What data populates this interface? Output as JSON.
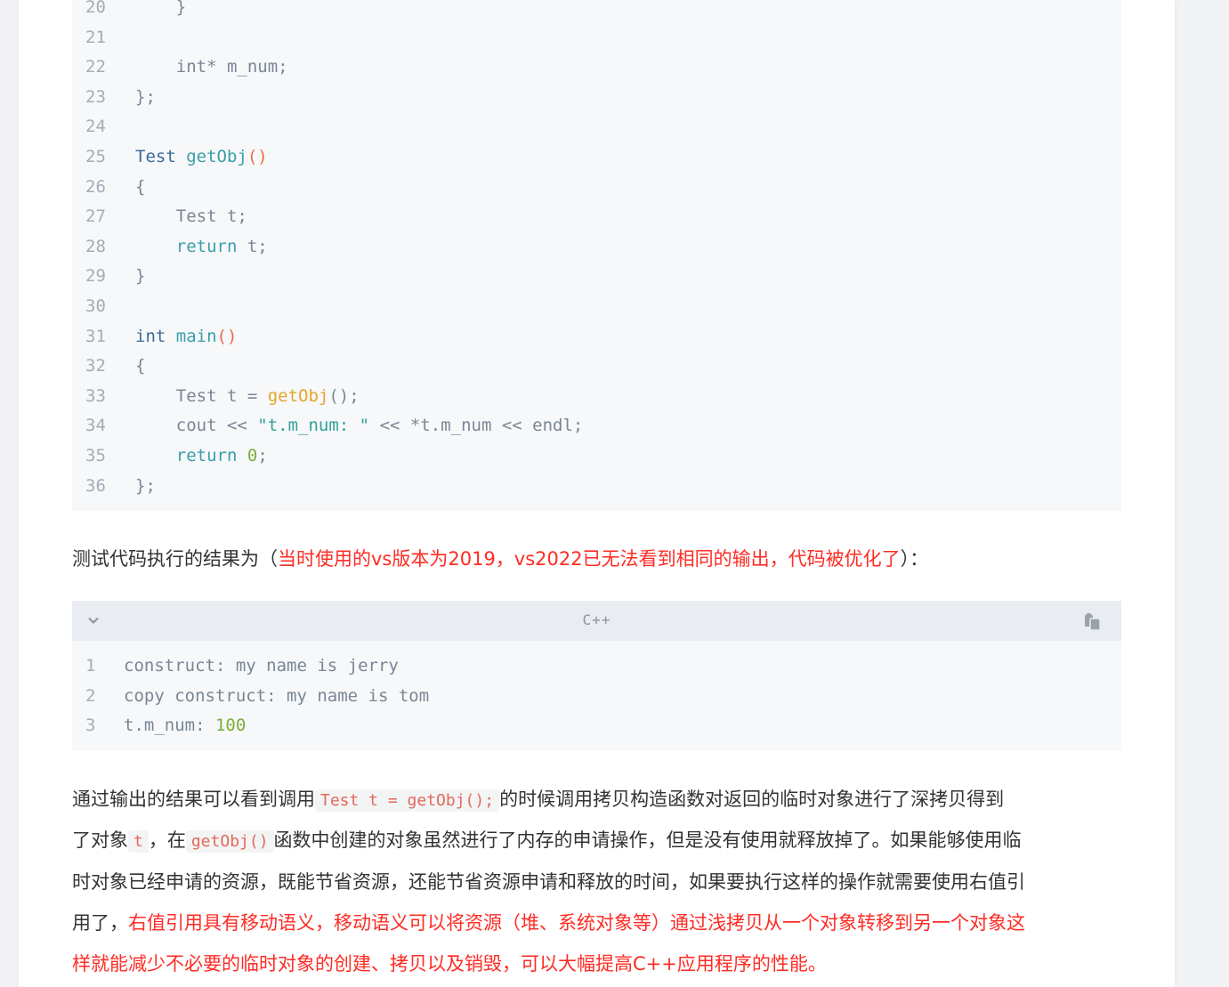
{
  "code_block_1": {
    "lines": [
      {
        "n": "20",
        "tokens": [
          {
            "t": "    }",
            "c": ""
          }
        ]
      },
      {
        "n": "21",
        "tokens": []
      },
      {
        "n": "22",
        "tokens": [
          {
            "t": "    int* m_num;",
            "c": ""
          }
        ]
      },
      {
        "n": "23",
        "tokens": [
          {
            "t": "};",
            "c": ""
          }
        ]
      },
      {
        "n": "24",
        "tokens": []
      },
      {
        "n": "25",
        "tokens": [
          {
            "t": "Test ",
            "c": "c-type"
          },
          {
            "t": "getObj",
            "c": "c-fn"
          },
          {
            "t": "()",
            "c": "c-paren"
          }
        ]
      },
      {
        "n": "26",
        "tokens": [
          {
            "t": "{",
            "c": ""
          }
        ]
      },
      {
        "n": "27",
        "tokens": [
          {
            "t": "    Test t;",
            "c": ""
          }
        ]
      },
      {
        "n": "28",
        "tokens": [
          {
            "t": "    ",
            "c": ""
          },
          {
            "t": "return",
            "c": "c-kw"
          },
          {
            "t": " t;",
            "c": ""
          }
        ]
      },
      {
        "n": "29",
        "tokens": [
          {
            "t": "}",
            "c": ""
          }
        ]
      },
      {
        "n": "30",
        "tokens": []
      },
      {
        "n": "31",
        "tokens": [
          {
            "t": "int ",
            "c": "c-type"
          },
          {
            "t": "main",
            "c": "c-fn"
          },
          {
            "t": "()",
            "c": "c-paren"
          }
        ]
      },
      {
        "n": "32",
        "tokens": [
          {
            "t": "{",
            "c": ""
          }
        ]
      },
      {
        "n": "33",
        "tokens": [
          {
            "t": "    Test t = ",
            "c": ""
          },
          {
            "t": "getObj",
            "c": "c-fnc"
          },
          {
            "t": "();",
            "c": ""
          }
        ]
      },
      {
        "n": "34",
        "tokens": [
          {
            "t": "    cout << ",
            "c": ""
          },
          {
            "t": "\"t.m_num: \"",
            "c": "c-str"
          },
          {
            "t": " << *t.m_num << endl;",
            "c": ""
          }
        ]
      },
      {
        "n": "35",
        "tokens": [
          {
            "t": "    ",
            "c": ""
          },
          {
            "t": "return",
            "c": "c-kw"
          },
          {
            "t": " ",
            "c": ""
          },
          {
            "t": "0",
            "c": "c-num"
          },
          {
            "t": ";",
            "c": ""
          }
        ]
      },
      {
        "n": "36",
        "tokens": [
          {
            "t": "};",
            "c": ""
          }
        ]
      }
    ]
  },
  "para1": {
    "prefix": "测试代码执行的结果为（",
    "red": "当时使用的vs版本为2019，vs2022已无法看到相同的输出，代码被优化了",
    "suffix": "）："
  },
  "code_block_2": {
    "language": "C++",
    "lines": [
      {
        "n": "1",
        "tokens": [
          {
            "t": "construct: my name is jerry",
            "c": ""
          }
        ]
      },
      {
        "n": "2",
        "tokens": [
          {
            "t": "copy construct: my name is tom",
            "c": ""
          }
        ]
      },
      {
        "n": "3",
        "tokens": [
          {
            "t": "t.m_num: ",
            "c": ""
          },
          {
            "t": "100",
            "c": "c-num"
          }
        ]
      }
    ]
  },
  "para2": {
    "l1_a": "通过输出的结果可以看到调用",
    "l1_code": "Test t = getObj();",
    "l1_b": "的时候调用拷贝构造函数对返回的临时对象进行了深拷贝得到",
    "l2_a": "了对象",
    "l2_code1": "t",
    "l2_b": "，在",
    "l2_code2": "getObj()",
    "l2_c": "函数中创建的对象虽然进行了内存的申请操作，但是没有使用就释放掉了。如果能够使用临",
    "l3": "时对象已经申请的资源，既能节省资源，还能节省资源申请和释放的时间，如果要执行这样的操作就需要使用右值引",
    "l4_a": "用了，",
    "l4_red": "右值引用具有移动语义，移动语义可以将资源（堆、系统对象等）通过浅拷贝从一个对象转移到另一个对象这",
    "l5_red": "样就能减少不必要的临时对象的创建、拷贝以及销毁，可以大幅提高C++应用程序的性能。"
  }
}
